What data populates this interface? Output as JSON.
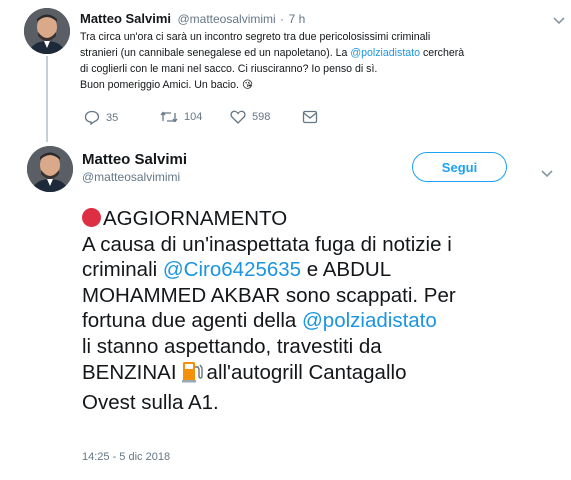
{
  "tweet1": {
    "author_name": "Matteo Salvimi",
    "author_handle": "@matteosalvimimi",
    "sep": "·",
    "time": "7 h",
    "text_1": "Tra circa un'ora ci sarà un incontro segreto tra due pericolosissimi criminali",
    "text_2": "stranieri (un cannibale senegalese ed un napoletano). La ",
    "mention": "@polziadistato",
    "text_2b": " cercherà",
    "text_3": "di coglierli con le mani nel sacco. Ci riusciranno? Io penso di sì.",
    "text_4": "Buon pomeriggio Amici. Un bacio. ",
    "emoji": "😘",
    "reply_count": "35",
    "retweet_count": "104",
    "like_count": "598"
  },
  "tweet2": {
    "author_name": "Matteo Salvimi",
    "author_handle": "@matteosalvimimi",
    "follow_label": "Segui",
    "line1": "AGGIORNAMENTO",
    "line2": "A causa di un'inaspettata fuga di notizie i",
    "line3a": "criminali ",
    "line3_mention": "@Ciro6425635",
    "line3b": " e ABDUL",
    "line4": "MOHAMMED AKBAR sono scappati. Per",
    "line5a": "fortuna due agenti della ",
    "line5_mention": "@polziadistato",
    "line6": "li stanno aspettando, travestiti da",
    "line7a": "BENZINAI",
    "line7b": "all'autogrill Cantagallo",
    "line8": "Ovest sulla A1.",
    "timestamp": "14:25 - 5 dic 2018"
  },
  "colors": {
    "link": "#1b95e0",
    "muted": "#657786",
    "follow": "#1da1f2",
    "red_dot": "#dd2e44"
  },
  "icons": [
    "reply-icon",
    "retweet-icon",
    "like-icon",
    "dm-icon",
    "chevron-down-icon",
    "fuel-pump-icon",
    "red-circle-icon"
  ]
}
